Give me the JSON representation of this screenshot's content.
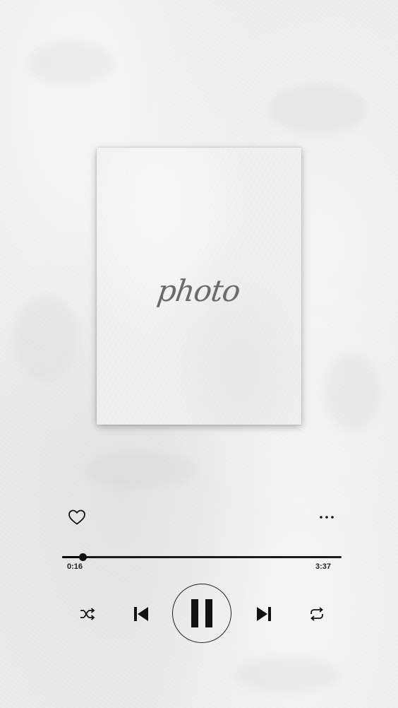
{
  "photo": {
    "label": "photo"
  },
  "player": {
    "elapsed": "0:16",
    "duration": "3:37",
    "progress_fraction": 0.074,
    "state": "playing"
  },
  "icons": {
    "like": "heart-outline-icon",
    "more": "more-horizontal-icon",
    "shuffle": "shuffle-icon",
    "previous": "skip-previous-icon",
    "pause": "pause-icon",
    "next": "skip-next-icon",
    "repeat": "repeat-icon"
  },
  "colors": {
    "background": "#ececec",
    "control": "#111111",
    "photo_label": "#6a6a6a"
  }
}
